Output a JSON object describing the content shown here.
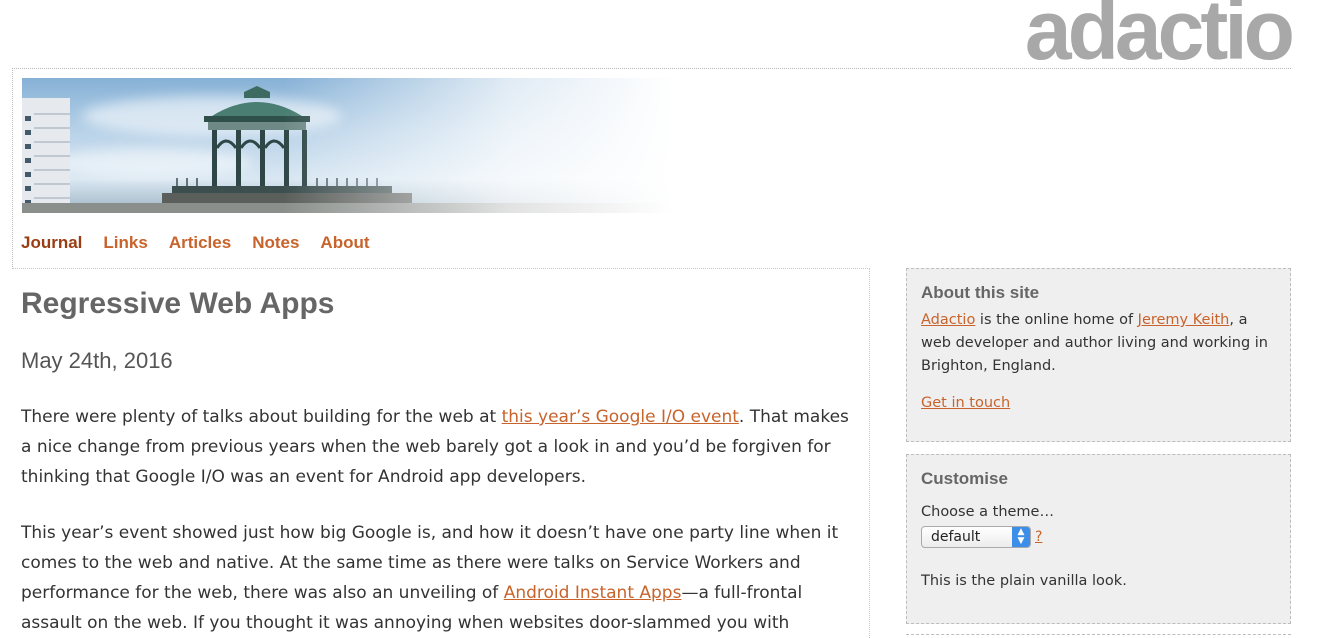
{
  "logo": {
    "text": "adactio"
  },
  "nav": {
    "items": [
      {
        "label": "Journal"
      },
      {
        "label": "Links"
      },
      {
        "label": "Articles"
      },
      {
        "label": "Notes"
      },
      {
        "label": "About"
      }
    ]
  },
  "post": {
    "title": "Regressive Web Apps",
    "date": "May 24th, 2016",
    "p1": {
      "before": "There were plenty of talks about building for the web at ",
      "link": "this year’s Google I/O event",
      "after": ". That makes a nice change from previous years when the web barely got a look in and you’d be forgiven for thinking that Google I/O was an event for Android app developers."
    },
    "p2": {
      "before": "This year’s event showed just how big Google is, and how it doesn’t have one party line when it comes to the web and native. At the same time as there were talks on Service Workers and performance for the web, there was also an unveiling of ",
      "link": "Android Instant Apps",
      "after": "—a full-frontal assault on the web. If you thought it was annoying when websites door-slammed you with"
    }
  },
  "sidebar": {
    "about": {
      "heading": "About this site",
      "link_site": "Adactio",
      "text1": " is the online home of ",
      "link_person": "Jeremy Keith",
      "text2": ", a web developer and author living and working in Brighton, England.",
      "contact": "Get in touch"
    },
    "customise": {
      "heading": "Customise",
      "prompt": "Choose a theme…",
      "selected": "default",
      "help": "?",
      "description": "This is the plain vanilla look."
    }
  },
  "colors": {
    "link": "#c8632c",
    "current_nav": "#9a3d12",
    "logo": "#a8a8a8",
    "sidebar_bg": "#efefef"
  }
}
